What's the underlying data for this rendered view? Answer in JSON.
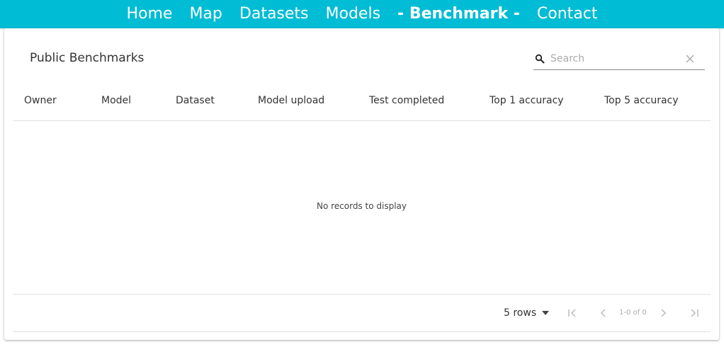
{
  "nav": {
    "items": [
      {
        "label": "Home",
        "active": false
      },
      {
        "label": "Map",
        "active": false
      },
      {
        "label": "Datasets",
        "active": false
      },
      {
        "label": "Models",
        "active": false
      },
      {
        "label": "- Benchmark -",
        "active": true
      },
      {
        "label": "Contact",
        "active": false
      }
    ],
    "bg_color": "#00bcd4"
  },
  "table": {
    "title": "Public Benchmarks",
    "search": {
      "placeholder": "Search",
      "value": ""
    },
    "columns": [
      "Owner",
      "Model",
      "Dataset",
      "Model upload",
      "Test completed",
      "Top 1 accuracy",
      "Top 5 accuracy"
    ],
    "rows": [],
    "empty_message": "No records to display"
  },
  "pagination": {
    "rows_label": "5 rows",
    "page_info": "1-0 of 0",
    "icons": [
      "first-page-icon",
      "prev-page-icon",
      "next-page-icon",
      "last-page-icon"
    ]
  }
}
